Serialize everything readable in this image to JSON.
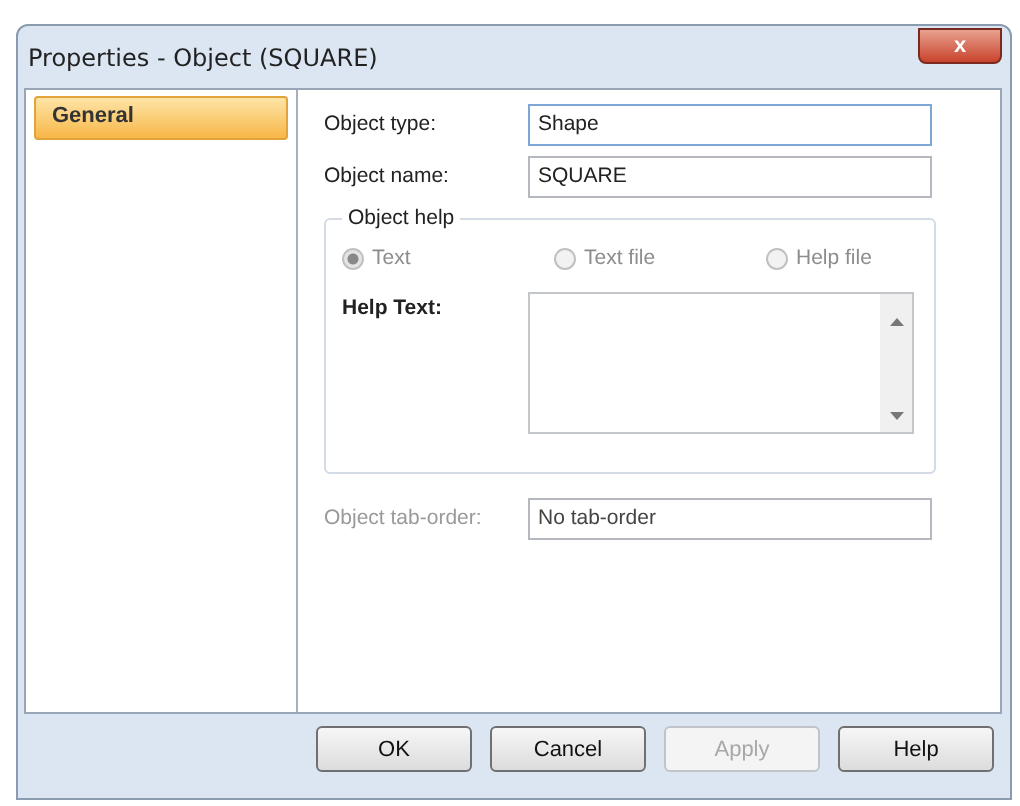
{
  "window": {
    "title": "Properties - Object (SQUARE)",
    "close_label": "x"
  },
  "sidebar": {
    "items": [
      {
        "label": "General",
        "selected": true
      }
    ]
  },
  "fields": [
    {
      "label": "Object type:",
      "value": "Shape",
      "focused": true
    },
    {
      "label": "Object name:",
      "value": "SQUARE",
      "focused": false
    }
  ],
  "object_help": {
    "title": "Object help",
    "options": [
      {
        "label": "Text",
        "selected": true,
        "disabled": true
      },
      {
        "label": "Text file",
        "selected": false,
        "disabled": true
      },
      {
        "label": "Help file",
        "selected": false,
        "disabled": true
      }
    ],
    "help_text_label": "Help Text:"
  },
  "tab_order": {
    "label": "Object tab-order:",
    "value": "No tab-order",
    "disabled": true
  },
  "buttons": [
    {
      "label": "OK",
      "disabled": false
    },
    {
      "label": "Cancel",
      "disabled": false
    },
    {
      "label": "Apply",
      "disabled": true
    },
    {
      "label": "Help",
      "disabled": false
    }
  ]
}
